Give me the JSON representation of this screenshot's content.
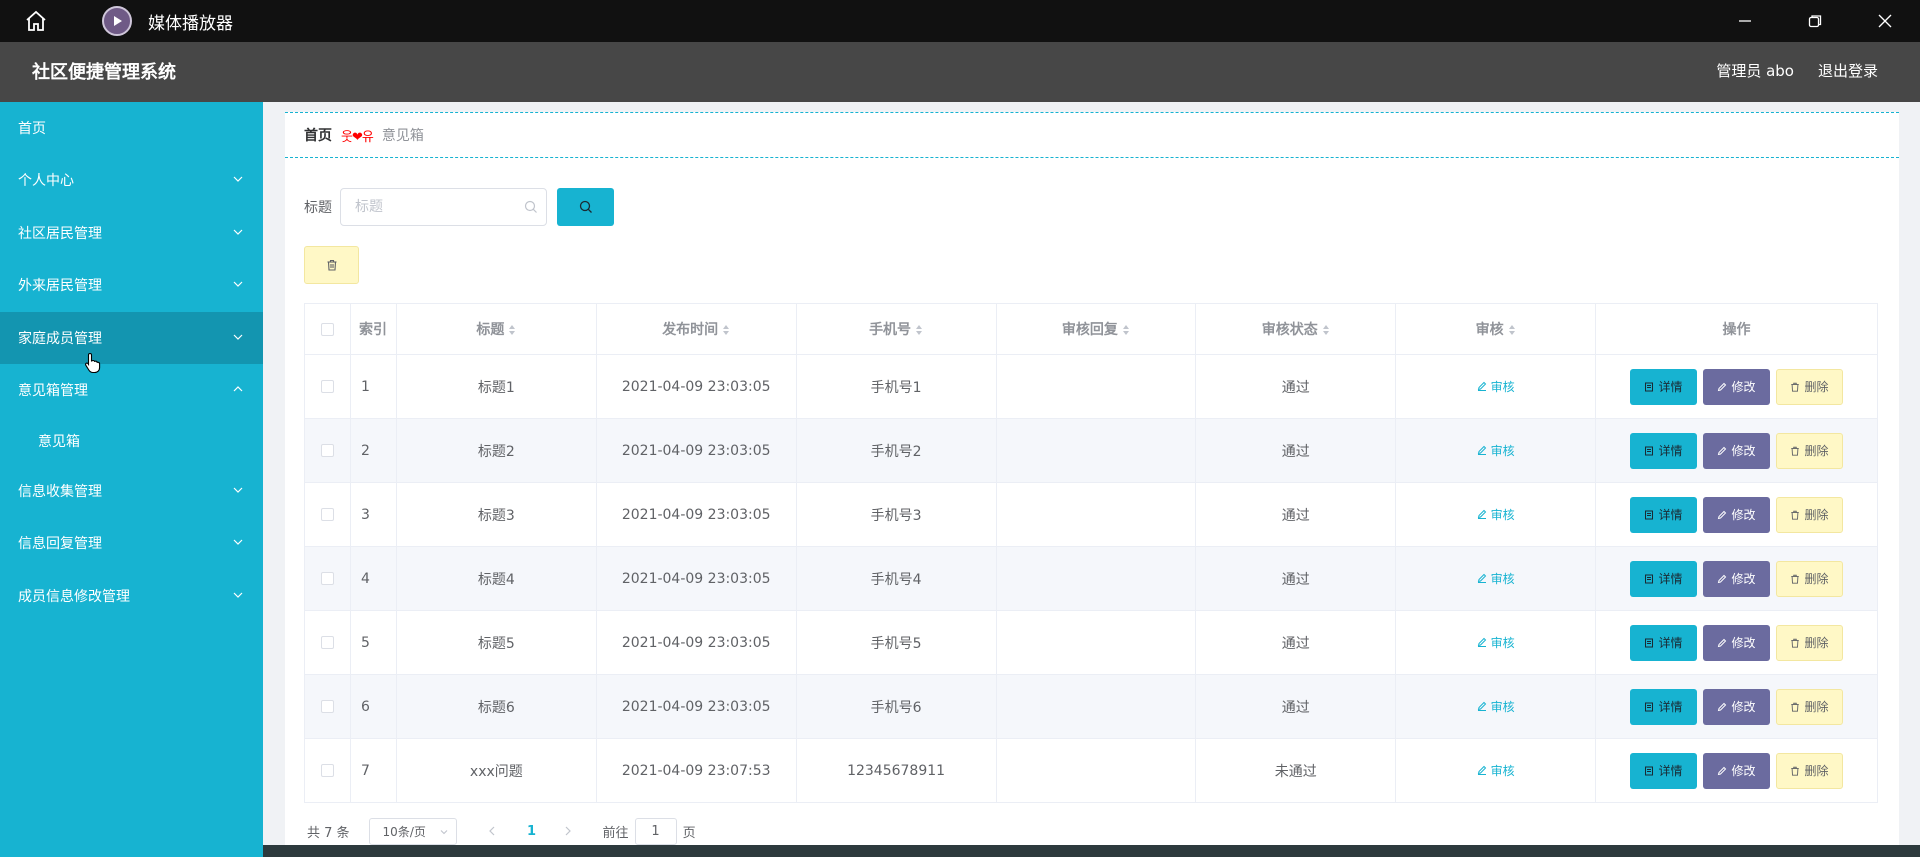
{
  "window": {
    "app_name": "媒体播放器",
    "home_icon": "home-icon",
    "app_icon": "play-icon",
    "controls": [
      "minimize-icon",
      "restore-icon",
      "close-icon"
    ]
  },
  "header": {
    "title": "社区便捷管理系统",
    "user": "管理员 abo",
    "logout": "退出登录"
  },
  "sidebar": {
    "items": [
      {
        "label": "首页",
        "has_chevron": false
      },
      {
        "label": "个人中心",
        "has_chevron": true
      },
      {
        "label": "社区居民管理",
        "has_chevron": true
      },
      {
        "label": "外来居民管理",
        "has_chevron": true
      },
      {
        "label": "家庭成员管理",
        "has_chevron": true
      },
      {
        "label": "意见箱管理",
        "has_chevron": true,
        "expanded": true
      },
      {
        "label": "意见箱",
        "sub": true
      },
      {
        "label": "信息收集管理",
        "has_chevron": true
      },
      {
        "label": "信息回复管理",
        "has_chevron": true
      },
      {
        "label": "成员信息修改管理",
        "has_chevron": true
      }
    ],
    "active_color": "#1395b0",
    "bg_color": "#17b3d1"
  },
  "breadcrumb": {
    "home": "首页",
    "separator": "웃❤유",
    "current": "意见箱"
  },
  "search": {
    "label": "标题",
    "placeholder": "标题",
    "value": ""
  },
  "table": {
    "headers": {
      "index": "索引",
      "title": "标题",
      "time": "发布时间",
      "phone": "手机号",
      "reply": "审核回复",
      "status": "审核状态",
      "audit": "审核",
      "ops": "操作"
    },
    "rows": [
      {
        "index": "1",
        "title": "标题1",
        "time": "2021-04-09 23:03:05",
        "phone": "手机号1",
        "reply": "",
        "status": "通过"
      },
      {
        "index": "2",
        "title": "标题2",
        "time": "2021-04-09 23:03:05",
        "phone": "手机号2",
        "reply": "",
        "status": "通过"
      },
      {
        "index": "3",
        "title": "标题3",
        "time": "2021-04-09 23:03:05",
        "phone": "手机号3",
        "reply": "",
        "status": "通过"
      },
      {
        "index": "4",
        "title": "标题4",
        "time": "2021-04-09 23:03:05",
        "phone": "手机号4",
        "reply": "",
        "status": "通过"
      },
      {
        "index": "5",
        "title": "标题5",
        "time": "2021-04-09 23:03:05",
        "phone": "手机号5",
        "reply": "",
        "status": "通过"
      },
      {
        "index": "6",
        "title": "标题6",
        "time": "2021-04-09 23:03:05",
        "phone": "手机号6",
        "reply": "",
        "status": "通过"
      },
      {
        "index": "7",
        "title": "xxx问题",
        "time": "2021-04-09 23:07:53",
        "phone": "12345678911",
        "reply": "",
        "status": "未通过"
      }
    ],
    "audit_label": "审核",
    "btn_detail": "详情",
    "btn_edit": "修改",
    "btn_delete": "删除"
  },
  "pagination": {
    "total": "共 7 条",
    "page_size": "10条/页",
    "current_page": "1",
    "goto_label": "前往",
    "goto_value": "1",
    "page_label": "页"
  },
  "colors": {
    "accent": "#17b3d1",
    "edit_button": "#6b6b9f",
    "delete_button": "#fff8c6",
    "header_bg": "#474747",
    "titlebar_bg": "#111111"
  }
}
